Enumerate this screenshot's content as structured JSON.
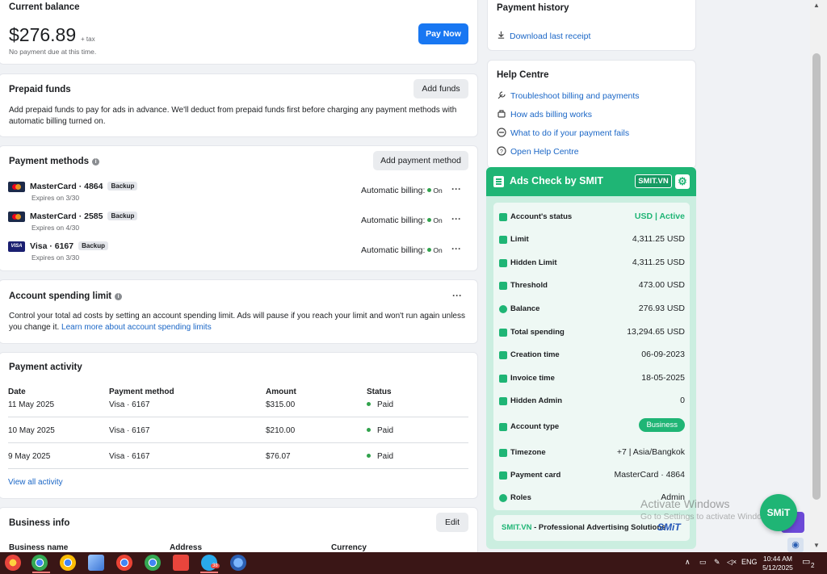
{
  "current_balance": {
    "title": "Current balance",
    "amount": "$276.89",
    "tax": "+ tax",
    "note": "No payment due at this time.",
    "pay_button": "Pay Now"
  },
  "prepaid": {
    "title": "Prepaid funds",
    "button": "Add funds",
    "description": "Add prepaid funds to pay for ads in advance. We'll deduct from prepaid funds first before charging any payment methods with automatic billing turned on."
  },
  "payment_methods": {
    "title": "Payment methods",
    "button": "Add payment method",
    "items": [
      {
        "name": "MasterCard · 4864",
        "badge": "Backup",
        "expires": "Expires on 3/30",
        "billing_label": "Automatic billing:",
        "billing_state": "On",
        "brand": "mastercard"
      },
      {
        "name": "MasterCard · 2585",
        "badge": "Backup",
        "expires": "Expires on 4/30",
        "billing_label": "Automatic billing:",
        "billing_state": "On",
        "brand": "mastercard"
      },
      {
        "name": "Visa · 6167",
        "badge": "Backup",
        "expires": "Expires on 3/30",
        "billing_label": "Automatic billing:",
        "billing_state": "On",
        "brand": "visa",
        "brand_text": "VISA"
      }
    ]
  },
  "spending_limit": {
    "title": "Account spending limit",
    "text": "Control your total ad costs by setting an account spending limit. Ads will pause if you reach your limit and won't run again unless you change it.",
    "link": "Learn more about account spending limits"
  },
  "activity": {
    "title": "Payment activity",
    "headers": [
      "Date",
      "Payment method",
      "Amount",
      "Status"
    ],
    "rows": [
      {
        "date": "11 May 2025",
        "method": "Visa · 6167",
        "amount": "$315.00",
        "status": "Paid"
      },
      {
        "date": "10 May 2025",
        "method": "Visa · 6167",
        "amount": "$210.00",
        "status": "Paid"
      },
      {
        "date": "9 May 2025",
        "method": "Visa · 6167",
        "amount": "$76.07",
        "status": "Paid"
      }
    ],
    "view_all": "View all activity"
  },
  "business_info": {
    "title": "Business info",
    "edit": "Edit",
    "columns": [
      "Business name",
      "Address",
      "Currency"
    ]
  },
  "payment_history": {
    "title": "Payment history",
    "download": "Download last receipt"
  },
  "help_centre": {
    "title": "Help Centre",
    "items": [
      {
        "label": "Troubleshoot billing and payments",
        "icon": "wrench-icon"
      },
      {
        "label": "How ads billing works",
        "icon": "billing-icon"
      },
      {
        "label": "What to do if your payment fails",
        "icon": "minus-circle-icon"
      },
      {
        "label": "Open Help Centre",
        "icon": "question-icon"
      }
    ]
  },
  "smit": {
    "title": "Ads Check by SMIT",
    "badge": "SMIT.VN",
    "rows": [
      {
        "label": "Account's status",
        "value": "USD | Active"
      },
      {
        "label": "Limit",
        "value": "4,311.25 USD"
      },
      {
        "label": "Hidden Limit",
        "value": "4,311.25 USD"
      },
      {
        "label": "Threshold",
        "value": "473.00 USD"
      },
      {
        "label": "Balance",
        "value": "276.93 USD"
      },
      {
        "label": "Total spending",
        "value": "13,294.65 USD"
      },
      {
        "label": "Creation time",
        "value": "06-09-2023"
      },
      {
        "label": "Invoice time",
        "value": "18-05-2025"
      },
      {
        "label": "Hidden Admin",
        "value": "0"
      },
      {
        "label": "Account type",
        "value": "Business"
      },
      {
        "label": "Timezone",
        "value": "+7 | Asia/Bangkok"
      },
      {
        "label": "Payment card",
        "value": "MasterCard · 4864"
      },
      {
        "label": "Roles",
        "value": "Admin"
      }
    ],
    "footer_brand": "SMIT.VN",
    "footer_text": " - Professional Advertising Solutions",
    "footer_logo": "SMiT",
    "fab": "SMiT",
    "accent": "#1fb575"
  },
  "watermark": {
    "line1": "Activate Windows",
    "line2": "Go to Settings to activate Windows."
  },
  "taskbar": {
    "lang": "ENG",
    "time": "10:44 AM",
    "date": "5/12/2025",
    "telegram_badge": "38",
    "notifications": "2"
  }
}
